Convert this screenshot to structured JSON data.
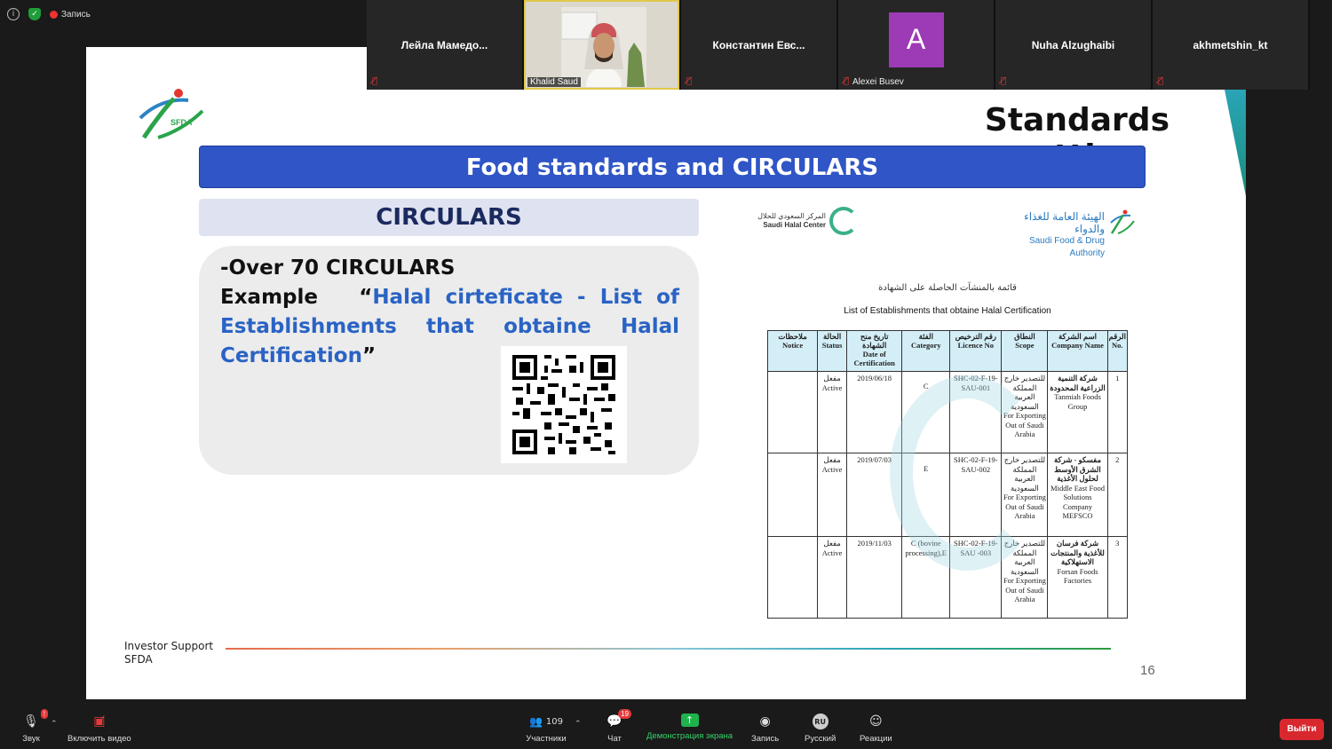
{
  "topbar": {
    "recording_label": "Запись"
  },
  "slide": {
    "title": "Standards setting",
    "banner": "Food standards and CIRCULARS",
    "circulars_heading": "CIRCULARS",
    "circulars_line1": "-Over 70 CIRCULARS",
    "example_word": "Example",
    "example_open": "“",
    "example_quote": "Halal cirteficate - List of Establishments that obtaine Halal Certification",
    "example_close": "”",
    "halal_center_ar": "المركز السعودي للحلال",
    "halal_center_en": "Saudi Halal Center",
    "sfda_ar": "الهيئة العامة للغذاء والدواء",
    "sfda_en": "Saudi Food & Drug Authority",
    "doc_title_ar": "قائمة بالمنشآت الحاصلة على الشهادة",
    "doc_title_en": "List of Establishments that obtaine Halal Certification",
    "footer_line1": "Investor Support",
    "footer_line2": "SFDA",
    "page_number": "16"
  },
  "table": {
    "headers": [
      {
        "ar": "ملاحظات",
        "en": "Notice"
      },
      {
        "ar": "الحالة",
        "en": "Status"
      },
      {
        "ar": "تاريخ منح الشهادة",
        "en": "Date of Certification"
      },
      {
        "ar": "الفئة",
        "en": "Category"
      },
      {
        "ar": "رقم الترخيص",
        "en": "Licence No"
      },
      {
        "ar": "النطاق",
        "en": "Scope"
      },
      {
        "ar": "اسم الشركة",
        "en": "Company Name"
      },
      {
        "ar": "الرقم",
        "en": "No."
      }
    ],
    "rows": [
      {
        "notice": "",
        "status_ar": "مفعل",
        "status": "Active",
        "date": "2019/06/18",
        "category": "C",
        "licence": "SHC-02-F-19-SAU-001",
        "scope_ar": "للتصدير خارج المملكة العربية السعودية",
        "scope": "For Exporting Out of Saudi Arabia",
        "company_ar": "شركة التنمية الزراعية المحدودة",
        "company": "Tanmiah Foods Group",
        "no": "1"
      },
      {
        "notice": "",
        "status_ar": "مفعل",
        "status": "Active",
        "date": "2019/07/03",
        "category": "E",
        "licence": "SHC-02-F-19-SAU-002",
        "scope_ar": "للتصدير خارج المملكة العربية السعودية",
        "scope": "For Exporting Out of Saudi Arabia",
        "company_ar": "مفسكو - شركة الشرق الأوسط لحلول الأغذية",
        "company": "Middle East Food Solutions Company MEFSCO",
        "no": "2"
      },
      {
        "notice": "",
        "status_ar": "مفعل",
        "status": "Active",
        "date": "2019/11/03",
        "category": "C (bovine processing),E",
        "licence": "SHC-02-F-19- SAU -003",
        "scope_ar": "للتصدير خارج المملكة العربية السعودية",
        "scope": "For Exporting Out of Saudi Arabia",
        "company_ar": "شركة فرسان للأغذية والمنتجات الاستهلاكية",
        "company": "Forsan Foods Factories",
        "no": "3"
      }
    ]
  },
  "participants": [
    {
      "name": "Лейла Мамедо...",
      "muted": true,
      "type": "name"
    },
    {
      "name": "Khalid Saud",
      "muted": false,
      "type": "video"
    },
    {
      "name": "Константин Евс...",
      "muted": true,
      "type": "name"
    },
    {
      "name": "Alexei Busev",
      "avatar_letter": "A",
      "muted": true,
      "type": "avatar"
    },
    {
      "name": "Nuha Alzughaibi",
      "muted": true,
      "type": "name"
    },
    {
      "name": "akhmetshin_kt",
      "muted": true,
      "type": "name"
    }
  ],
  "toolbar": {
    "sound": "Звук",
    "sound_badge": "!",
    "video": "Включить видео",
    "participants": "Участники",
    "participants_count": "109",
    "chat": "Чат",
    "chat_badge": "19",
    "share": "Демонстрация экрана",
    "record": "Запись",
    "language": "Русский",
    "language_code": "RU",
    "reactions": "Реакции",
    "leave": "Выйти"
  },
  "colors": {
    "banner": "#2f55c6",
    "share_green": "#1fb34c",
    "leave_red": "#d9272e",
    "link_blue": "#2a63c4"
  }
}
